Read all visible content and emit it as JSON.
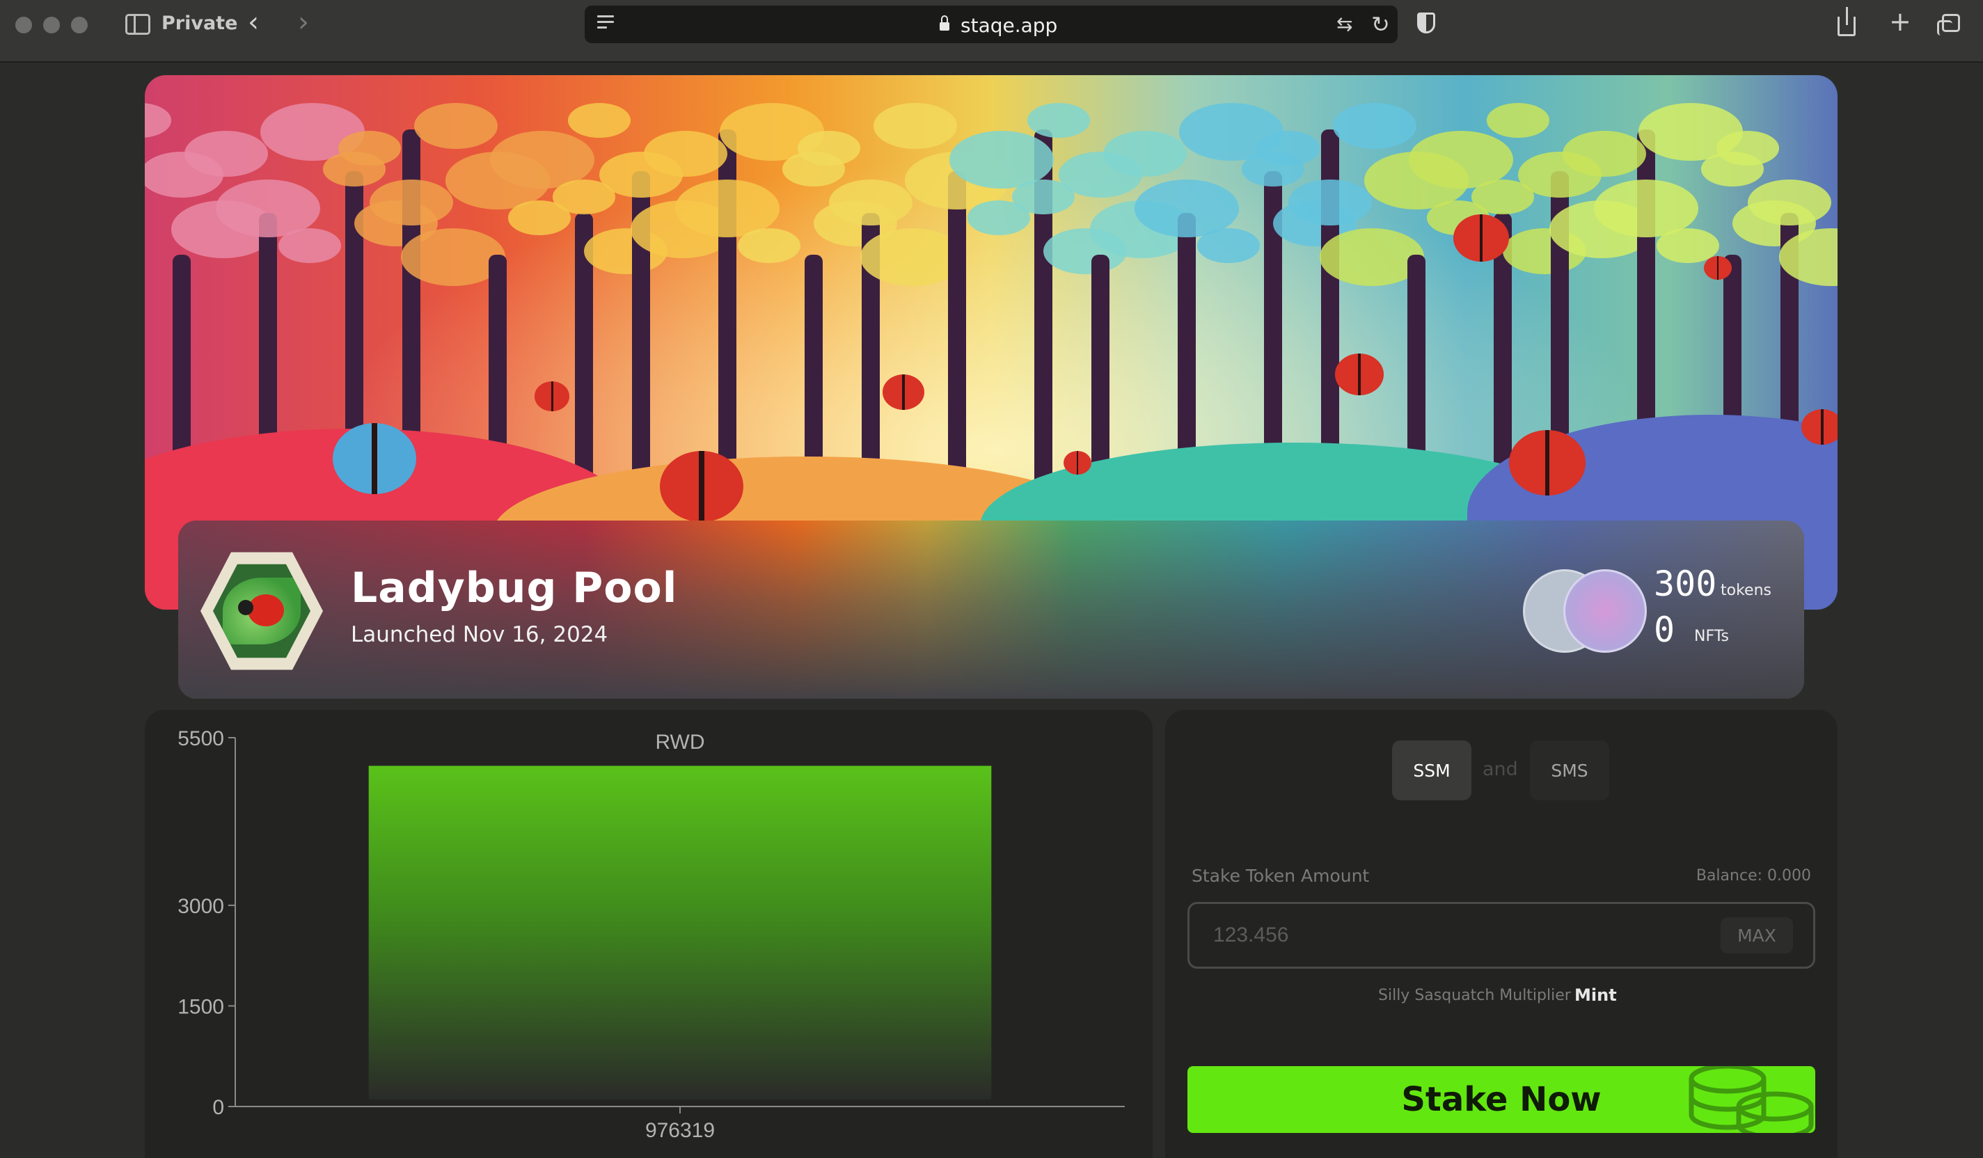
{
  "browser": {
    "mode_label": "Private",
    "url": "staqe.app"
  },
  "pool": {
    "name": "Ladybug Pool",
    "launched": "Launched Nov 16, 2024",
    "tokens_count": "300",
    "tokens_label": "tokens",
    "nfts_count": "0",
    "nfts_label": "NFTs"
  },
  "chart_data": {
    "type": "bar",
    "title": "RWD",
    "categories": [
      "976319"
    ],
    "values": [
      5080
    ],
    "ylim": [
      0,
      5500
    ],
    "yticks": [
      0,
      1500,
      3000,
      5500
    ],
    "xlabel": "",
    "ylabel": "",
    "bar_color_top": "#5ac21a",
    "bar_color_bottom": "#2a2b29"
  },
  "stake": {
    "toggle_ssm": "SSM",
    "toggle_and": "and",
    "toggle_sms": "SMS",
    "amount_label": "Stake Token Amount",
    "balance": "Balance: 0.000",
    "amount_placeholder": "123.456",
    "max_label": "MAX",
    "multiplier_label": "Silly Sasquatch Multiplier",
    "mint_label": "Mint",
    "stake_button": "Stake Now"
  },
  "colors": {
    "accent_green": "#63e711",
    "panel_bg": "#232422",
    "page_bg": "#2b2c2a"
  }
}
